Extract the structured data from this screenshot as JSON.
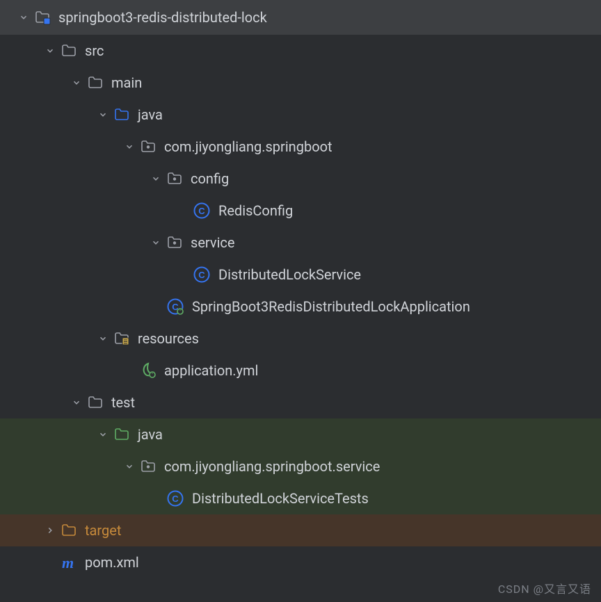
{
  "tree": {
    "root": {
      "label": "springboot3-redis-distributed-lock",
      "icon": "module-folder",
      "expanded": true
    },
    "items": [
      {
        "label": "src",
        "icon": "folder",
        "expanded": true,
        "depth": 1
      },
      {
        "label": "main",
        "icon": "folder",
        "expanded": true,
        "depth": 2
      },
      {
        "label": "java",
        "icon": "folder-source",
        "expanded": true,
        "depth": 3
      },
      {
        "label": "com.jiyongliang.springboot",
        "icon": "package",
        "expanded": true,
        "depth": 4
      },
      {
        "label": "config",
        "icon": "package",
        "expanded": true,
        "depth": 5
      },
      {
        "label": "RedisConfig",
        "icon": "class",
        "expanded": null,
        "depth": 6
      },
      {
        "label": "service",
        "icon": "package",
        "expanded": true,
        "depth": 5
      },
      {
        "label": "DistributedLockService",
        "icon": "class",
        "expanded": null,
        "depth": 6
      },
      {
        "label": "SpringBoot3RedisDistributedLockApplication",
        "icon": "class-runnable",
        "expanded": null,
        "depth": 5
      },
      {
        "label": "resources",
        "icon": "folder-resources",
        "expanded": true,
        "depth": 3
      },
      {
        "label": "application.yml",
        "icon": "spring-config",
        "expanded": null,
        "depth": 4
      },
      {
        "label": "test",
        "icon": "folder",
        "expanded": true,
        "depth": 2
      },
      {
        "label": "java",
        "icon": "folder-test",
        "expanded": true,
        "depth": 3,
        "bg": "green"
      },
      {
        "label": "com.jiyongliang.springboot.service",
        "icon": "package",
        "expanded": true,
        "depth": 4,
        "bg": "green"
      },
      {
        "label": "DistributedLockServiceTests",
        "icon": "class",
        "expanded": null,
        "depth": 5,
        "bg": "green"
      },
      {
        "label": "target",
        "icon": "folder-orange",
        "expanded": false,
        "depth": 1,
        "bg": "orange",
        "labelClass": "orange"
      },
      {
        "label": "pom.xml",
        "icon": "maven",
        "expanded": null,
        "depth": 1
      }
    ]
  },
  "watermark": "CSDN @又言又语"
}
